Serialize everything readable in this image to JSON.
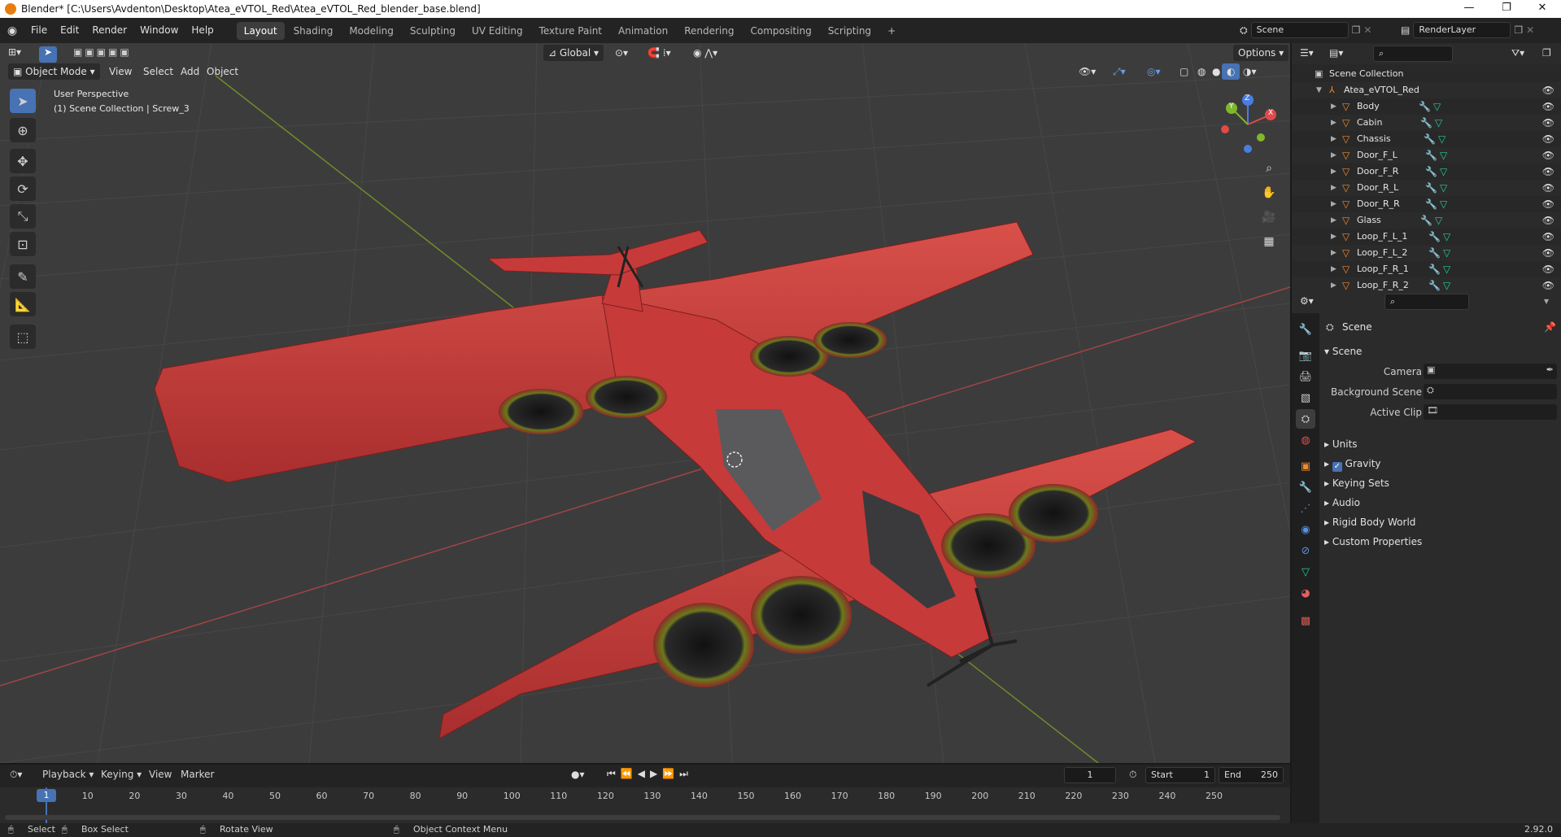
{
  "window": {
    "title": "Blender* [C:\\Users\\Avdenton\\Desktop\\Atea_eVTOL_Red\\Atea_eVTOL_Red_blender_base.blend]",
    "controls": [
      "—",
      "❐",
      "✕"
    ]
  },
  "menubar": {
    "items": [
      "File",
      "Edit",
      "Render",
      "Window",
      "Help"
    ],
    "workspaces": [
      "Layout",
      "Shading",
      "Modeling",
      "Sculpting",
      "UV Editing",
      "Texture Paint",
      "Animation",
      "Rendering",
      "Compositing",
      "Scripting"
    ],
    "active_workspace": "Layout",
    "add_workspace": "+",
    "scene": "Scene",
    "view_layer": "RenderLayer"
  },
  "viewport": {
    "transform_orientation": "Global",
    "options_label": "Options",
    "mode": "Object Mode",
    "menus": [
      "View",
      "Select",
      "Add",
      "Object"
    ],
    "info_line1": "User Perspective",
    "info_line2": "(1) Scene Collection | Screw_3",
    "gizmo_axes": [
      "X",
      "Y",
      "Z"
    ],
    "colors": {
      "bg": "#3c3c3c",
      "grid": "#4a4a4a",
      "x_axis": "#b84a4a",
      "y_axis": "#7f9a2e",
      "aircraft": "#c73a3a"
    }
  },
  "outliner": {
    "root": "Scene Collection",
    "collection": "Atea_eVTOL_Red",
    "objects": [
      "Body",
      "Cabin",
      "Chassis",
      "Door_F_L",
      "Door_F_R",
      "Door_R_L",
      "Door_R_R",
      "Glass",
      "Loop_F_L_1",
      "Loop_F_L_2",
      "Loop_F_R_1",
      "Loop_F_R_2"
    ]
  },
  "properties": {
    "context": "Scene",
    "panel_title": "Scene",
    "fields": [
      {
        "label": "Camera",
        "value": ""
      },
      {
        "label": "Background Scene",
        "value": ""
      },
      {
        "label": "Active Clip",
        "value": ""
      }
    ],
    "subpanels": [
      "Units",
      "Gravity",
      "Keying Sets",
      "Audio",
      "Rigid Body World",
      "Custom Properties"
    ],
    "gravity_checked": true
  },
  "timeline": {
    "menus": [
      "Playback",
      "Keying",
      "View",
      "Marker"
    ],
    "current_frame": "1",
    "start_label": "Start",
    "start": "1",
    "end_label": "End",
    "end": "250",
    "ticks": [
      "1",
      "10",
      "20",
      "30",
      "40",
      "50",
      "60",
      "70",
      "80",
      "90",
      "100",
      "110",
      "120",
      "130",
      "140",
      "150",
      "160",
      "170",
      "180",
      "190",
      "200",
      "210",
      "220",
      "230",
      "240",
      "250"
    ]
  },
  "statusbar": {
    "hints": [
      "Select",
      "Box Select",
      "Rotate View",
      "Object Context Menu"
    ],
    "version": "2.92.0"
  }
}
